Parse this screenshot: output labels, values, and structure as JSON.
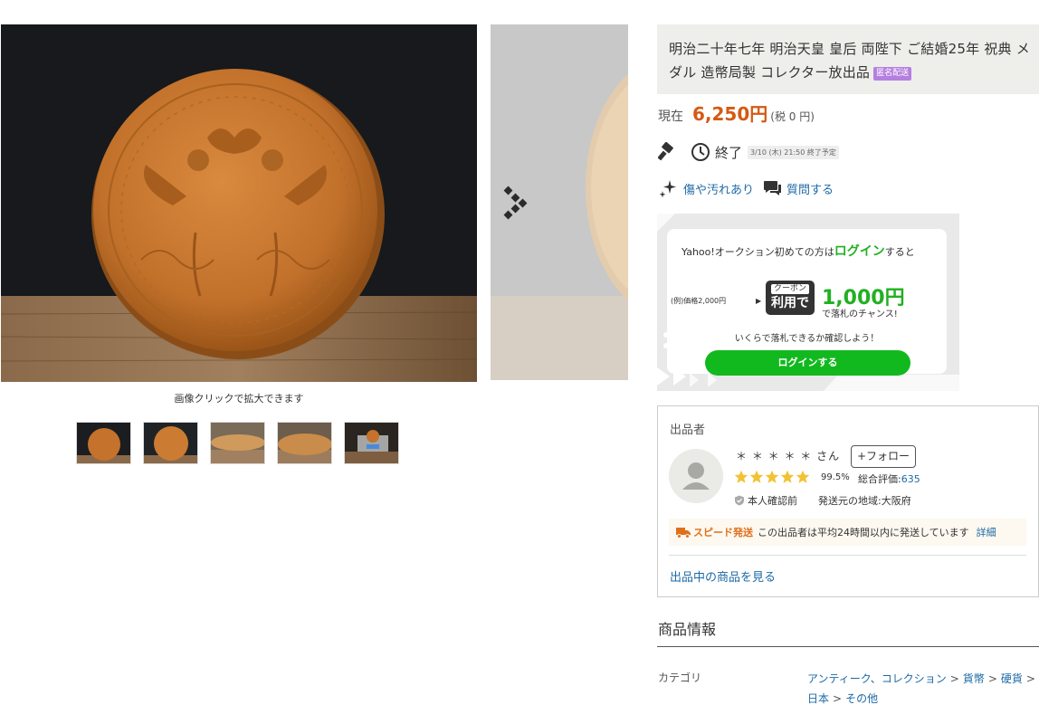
{
  "gallery": {
    "zoom_hint": "画像クリックで拡大できます",
    "thumbnail_count": 5
  },
  "item": {
    "title": "明治二十年七年 明治天皇 皇后 両陛下 ご結婚25年 祝典 メダル 造幣局製 コレクター放出品",
    "anon_badge": "匿名配送",
    "price_label": "現在",
    "price_value": "6,250円",
    "price_tax": "(税 0 円)",
    "status": "終了",
    "end_time": "3/10 (木) 21:50 終了予定",
    "condition_link": "傷や汚れあり",
    "question_link": "質問する"
  },
  "coupon": {
    "line1_prefix": "Yahoo!オークション初めての方は",
    "line1_highlight": "ログイン",
    "line1_suffix": "すると",
    "example": "(例)価格2,000円",
    "arrow": "▶",
    "badge_top": "クーポン",
    "badge_bottom": "利用で",
    "amount": "1,000円",
    "chance": "で落札のチャンス!",
    "check": "いくらで落札できるか確認しよう！",
    "button": "ログインする"
  },
  "seller": {
    "heading": "出品者",
    "name": "＊ ＊ ＊ ＊ ＊ さん",
    "follow": "+フォロー",
    "stars": 5,
    "percent": "99.5%",
    "rating_label": "総合評価:",
    "rating_count": "635",
    "verify": "本人確認前",
    "ship_from": "発送元の地域:大阪府",
    "speed_label": "スピード発送",
    "speed_text": "この出品者は平均24時間以内に発送しています",
    "speed_detail": "詳細",
    "see_items": "出品中の商品を見る"
  },
  "info": {
    "heading": "商品情報",
    "category_label": "カテゴリ",
    "categories": [
      "アンティーク、コレクション",
      "貨幣",
      "硬貨",
      "日本",
      "その他"
    ]
  },
  "colors": {
    "price": "#d45a14",
    "link": "#1d6aa6",
    "login_green": "#12b91e",
    "anon_badge": "#b57fe0",
    "speed": "#e0701a"
  }
}
